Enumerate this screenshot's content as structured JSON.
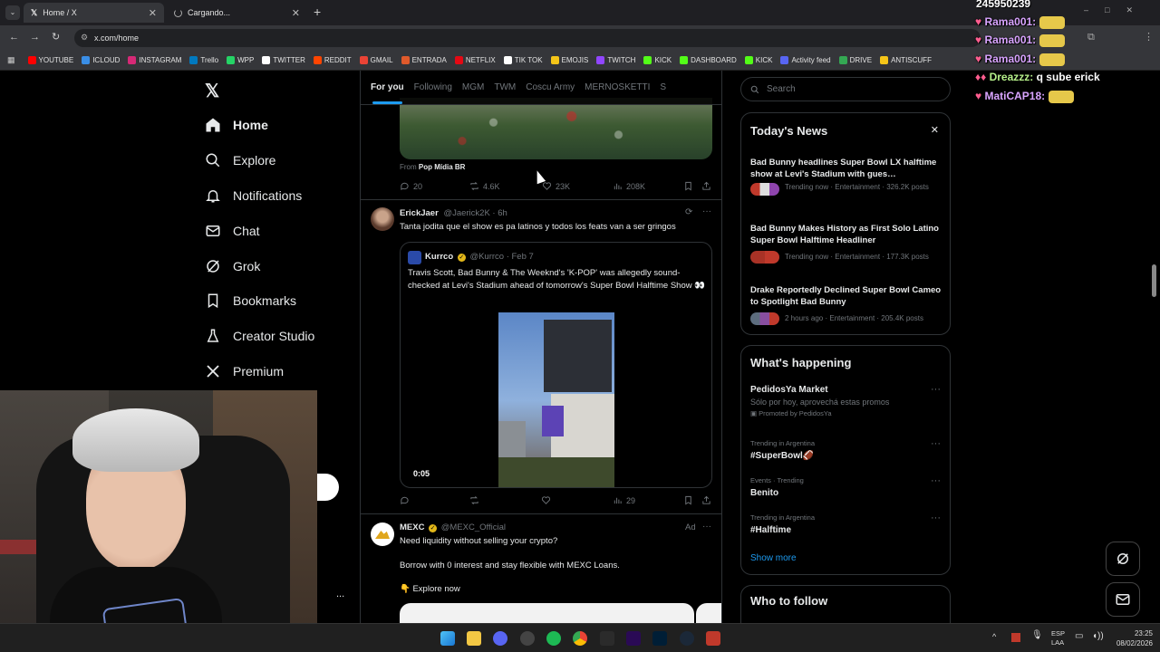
{
  "browser": {
    "tabs": [
      {
        "label": "Home / X"
      },
      {
        "label": "Cargando..."
      }
    ],
    "url": "x.com/home",
    "bookmarks": [
      "YOUTUBE",
      "ICLOUD",
      "INSTAGRAM",
      "Trello",
      "WPP",
      "TWITTER",
      "REDDIT",
      "GMAIL",
      "ENTRADA",
      "NETFLIX",
      "TIK TOK",
      "EMOJIS",
      "TWITCH",
      "KICK",
      "DASHBOARD",
      "KICK",
      "Activity feed",
      "DRIVE",
      "ANTISCUFF"
    ],
    "bookmark_colors": [
      "#ff0000",
      "#3a8ee6",
      "#d62976",
      "#0079bf",
      "#25d366",
      "#ffffff",
      "#ff4500",
      "#ea4335",
      "#e05a2b",
      "#e50914",
      "#ffffff",
      "#f5c518",
      "#9146ff",
      "#53fc18",
      "#53fc18",
      "#53fc18",
      "#5865f2",
      "#34a853",
      "#f5c518"
    ]
  },
  "sidebar": {
    "items": [
      {
        "label": "Home",
        "icon": "home-icon"
      },
      {
        "label": "Explore",
        "icon": "search-icon"
      },
      {
        "label": "Notifications",
        "icon": "bell-icon"
      },
      {
        "label": "Chat",
        "icon": "mail-icon"
      },
      {
        "label": "Grok",
        "icon": "grok-icon"
      },
      {
        "label": "Bookmarks",
        "icon": "bookmark-icon"
      },
      {
        "label": "Creator Studio",
        "icon": "flask-icon"
      },
      {
        "label": "Premium",
        "icon": "x-logo-icon"
      }
    ],
    "more": "..."
  },
  "timeline": {
    "tabs": [
      "For you",
      "Following",
      "MGM",
      "TWM",
      "Coscu Army",
      "MERNOSKETTI",
      "S"
    ],
    "tweet1": {
      "from_prefix": "From",
      "from": "Pop Mídia BR",
      "replies": "20",
      "reposts": "4.6K",
      "likes": "23K",
      "views": "208K"
    },
    "tweet2": {
      "name": "ErickJaer",
      "handle": "@Jaerick2K · 6h",
      "text": "Tanta jodita que el show es pa latinos y todos los feats van a ser gringos",
      "quote": {
        "name": "Kurrco",
        "handle": "@Kurrco · Feb 7",
        "text": "Travis Scott, Bad Bunny & The Weeknd's 'K-POP' was allegedly sound-checked at Levi's Stadium ahead of tomorrow's Super Bowl Halftime Show 👀",
        "duration": "0:05"
      },
      "views": "29"
    },
    "tweet3": {
      "name": "MEXC",
      "handle": "@MEXC_Official",
      "ad": "Ad",
      "line1": "Need liquidity without selling your crypto?",
      "line2": "Borrow with 0 interest and stay flexible with MEXC Loans.",
      "line3": "👇 Explore now"
    }
  },
  "right": {
    "search_placeholder": "Search",
    "news_title": "Today's News",
    "news": [
      {
        "title": "Bad Bunny headlines Super Bowl LX halftime show at Levi's Stadium with gues…",
        "meta": "Trending now · Entertainment · 326.2K posts"
      },
      {
        "title": "Bad Bunny Makes History as First Solo Latino Super Bowl Halftime Headliner",
        "meta": "Trending now · Entertainment · 177.3K posts"
      },
      {
        "title": "Drake Reportedly Declined Super Bowl Cameo to Spotlight Bad Bunny",
        "meta": "2 hours ago · Entertainment · 205.4K posts"
      }
    ],
    "happening_title": "What's happening",
    "trends": [
      {
        "context": "",
        "title": "PedidosYa Market",
        "sub": "Sólo por hoy, aprovechá estas promos",
        "promo": "Promoted by PedidosYa"
      },
      {
        "context": "Trending in Argentina",
        "title": "#SuperBowl🏈"
      },
      {
        "context": "Events · Trending",
        "title": "Benito"
      },
      {
        "context": "Trending in Argentina",
        "title": "#Halftime"
      }
    ],
    "show_more": "Show more",
    "who_to_follow": "Who to follow"
  },
  "overlay": {
    "counter": "245950239",
    "chat": [
      {
        "user": "Rama001:",
        "msg": ""
      },
      {
        "user": "Rama001:",
        "msg": ""
      },
      {
        "user": "Rama001:",
        "msg": ""
      },
      {
        "user": "Dreazzz:",
        "msg": "q sube erick"
      },
      {
        "user": "MatiCAP18:",
        "msg": ""
      }
    ]
  },
  "system": {
    "lang": "ESP",
    "lang2": "LAA",
    "time": "23:25",
    "date": "08/02/2026"
  }
}
